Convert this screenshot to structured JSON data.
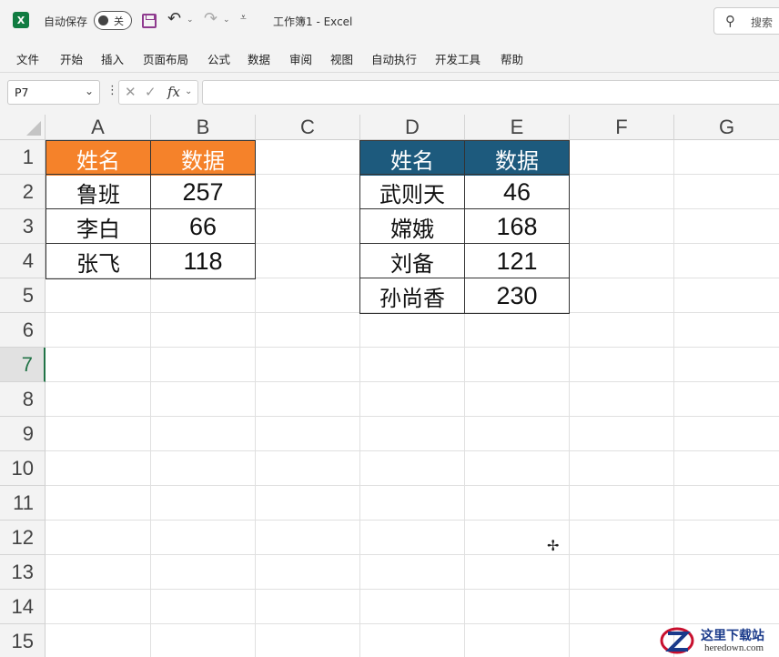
{
  "titlebar": {
    "app_icon": "excel-logo",
    "autosave_label": "自动保存",
    "autosave_state": "关",
    "doc_title": "工作簿1  -  Excel",
    "search_label": "搜索"
  },
  "ribbon": {
    "tabs": [
      "文件",
      "开始",
      "插入",
      "页面布局",
      "公式",
      "数据",
      "审阅",
      "视图",
      "自动执行",
      "开发工具",
      "帮助"
    ]
  },
  "formula_bar": {
    "name_box": "P7",
    "fx_label": "fx",
    "formula": ""
  },
  "sheet": {
    "columns": [
      "A",
      "B",
      "C",
      "D",
      "E",
      "F",
      "G"
    ],
    "rows": [
      "1",
      "2",
      "3",
      "4",
      "5",
      "6",
      "7",
      "8",
      "9",
      "10",
      "11",
      "12",
      "13",
      "14",
      "15"
    ],
    "active_row": "7",
    "table1": {
      "header": [
        "姓名",
        "数据"
      ],
      "header_color": "#f5822a",
      "rows": [
        [
          "鲁班",
          "257"
        ],
        [
          "李白",
          "66"
        ],
        [
          "张飞",
          "118"
        ]
      ]
    },
    "table2": {
      "header": [
        "姓名",
        "数据"
      ],
      "header_color": "#1d5a7d",
      "rows": [
        [
          "武则天",
          "46"
        ],
        [
          "嫦娥",
          "168"
        ],
        [
          "刘备",
          "121"
        ],
        [
          "孙尚香",
          "230"
        ]
      ]
    }
  },
  "watermark": {
    "cn": "这里下载站",
    "en": "heredown.com"
  }
}
